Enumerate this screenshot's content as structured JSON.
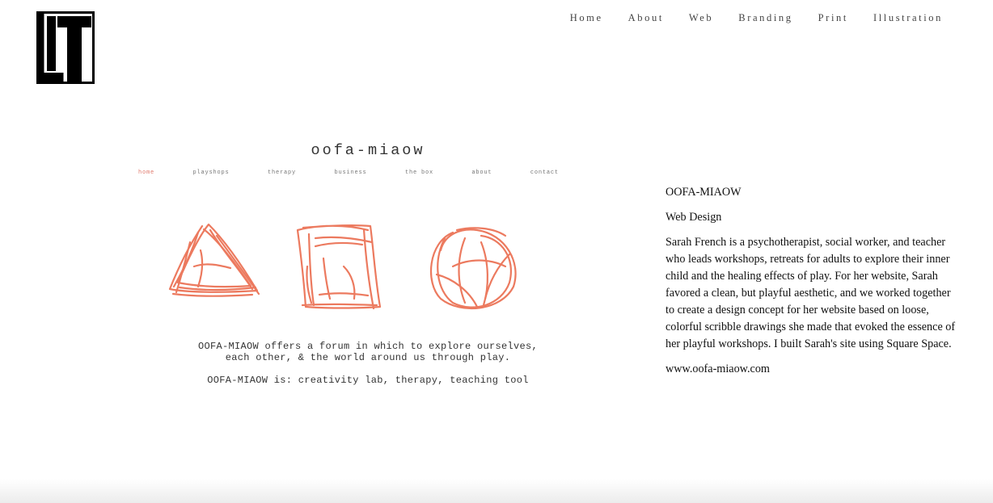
{
  "logo": {
    "alt": "LT",
    "colors": {
      "ink": "#000000",
      "paper": "#ffffff"
    }
  },
  "nav": {
    "items": [
      "Home",
      "About",
      "Web",
      "Branding",
      "Print",
      "Illustration"
    ]
  },
  "project_screenshot": {
    "site_title": "oofa-miaow",
    "nav_items": [
      "home",
      "playshops",
      "therapy",
      "business",
      "the box",
      "about",
      "contact"
    ],
    "active_nav": "home",
    "accent_color": "#ea6c4e",
    "tagline_line1": "OOFA-MIAOW offers a forum in which to explore ourselves,",
    "tagline_line2": "each other, & the world around us through play.",
    "is_line": "OOFA-MIAOW is: creativity lab, therapy, teaching tool"
  },
  "project": {
    "title": "OOFA-MIAOW",
    "category": "Web Design",
    "description": "Sarah French is a psychotherapist, social worker, and teacher who leads workshops, retreats for adults to explore their inner child and the healing effects of play. For her website, Sarah favored a clean, but playful aesthetic, and we worked together to create a design concept for her website based on loose, colorful scribble drawings she made that evoked the essence of her playful workshops. I built Sarah's site using Square Space.",
    "link": "www.oofa-miaow.com"
  }
}
